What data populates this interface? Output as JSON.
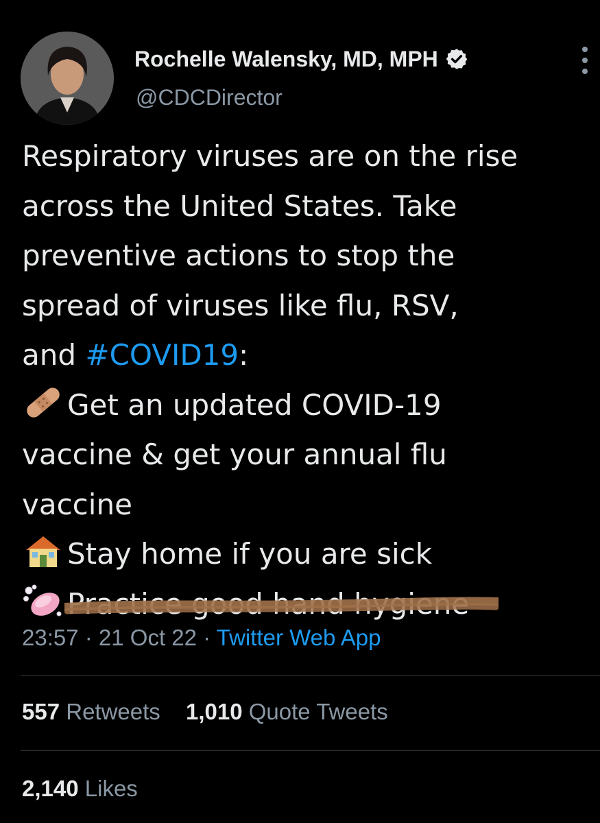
{
  "author": {
    "display_name": "Rochelle Walensky, MD, MPH",
    "handle": "@CDCDirector",
    "verified": true,
    "avatar_icon": "profile-photo"
  },
  "tweet": {
    "lines": [
      {
        "text": "Respiratory viruses are on the rise"
      },
      {
        "text": "across the United States. Take"
      },
      {
        "text": "preventive actions to stop the"
      },
      {
        "text": "spread of viruses like flu, RSV,"
      },
      {
        "prefix": "and ",
        "hashtag": "#COVID19",
        "suffix": ":"
      },
      {
        "emoji": "adhesive-bandage-icon",
        "text": "Get an updated COVID-19"
      },
      {
        "text": "vaccine & get your annual flu"
      },
      {
        "text": "vaccine"
      },
      {
        "emoji": "house-icon",
        "text": "Stay home if you are sick"
      },
      {
        "emoji": "soap-icon",
        "text": "Practice good hand hygiene",
        "scribbled_out": true
      }
    ]
  },
  "meta": {
    "time": "23:57",
    "separator": " · ",
    "date": "21 Oct 22",
    "source": "Twitter Web App"
  },
  "stats": {
    "retweets_count": "557",
    "retweets_label": "Retweets",
    "quotes_count": "1,010",
    "quotes_label": "Quote Tweets",
    "likes_count": "2,140",
    "likes_label": "Likes"
  },
  "colors": {
    "background": "#000000",
    "text": "#e7e9ea",
    "secondary": "#8b98a5",
    "link": "#1d9bf0",
    "scribble": "#a0714a"
  }
}
